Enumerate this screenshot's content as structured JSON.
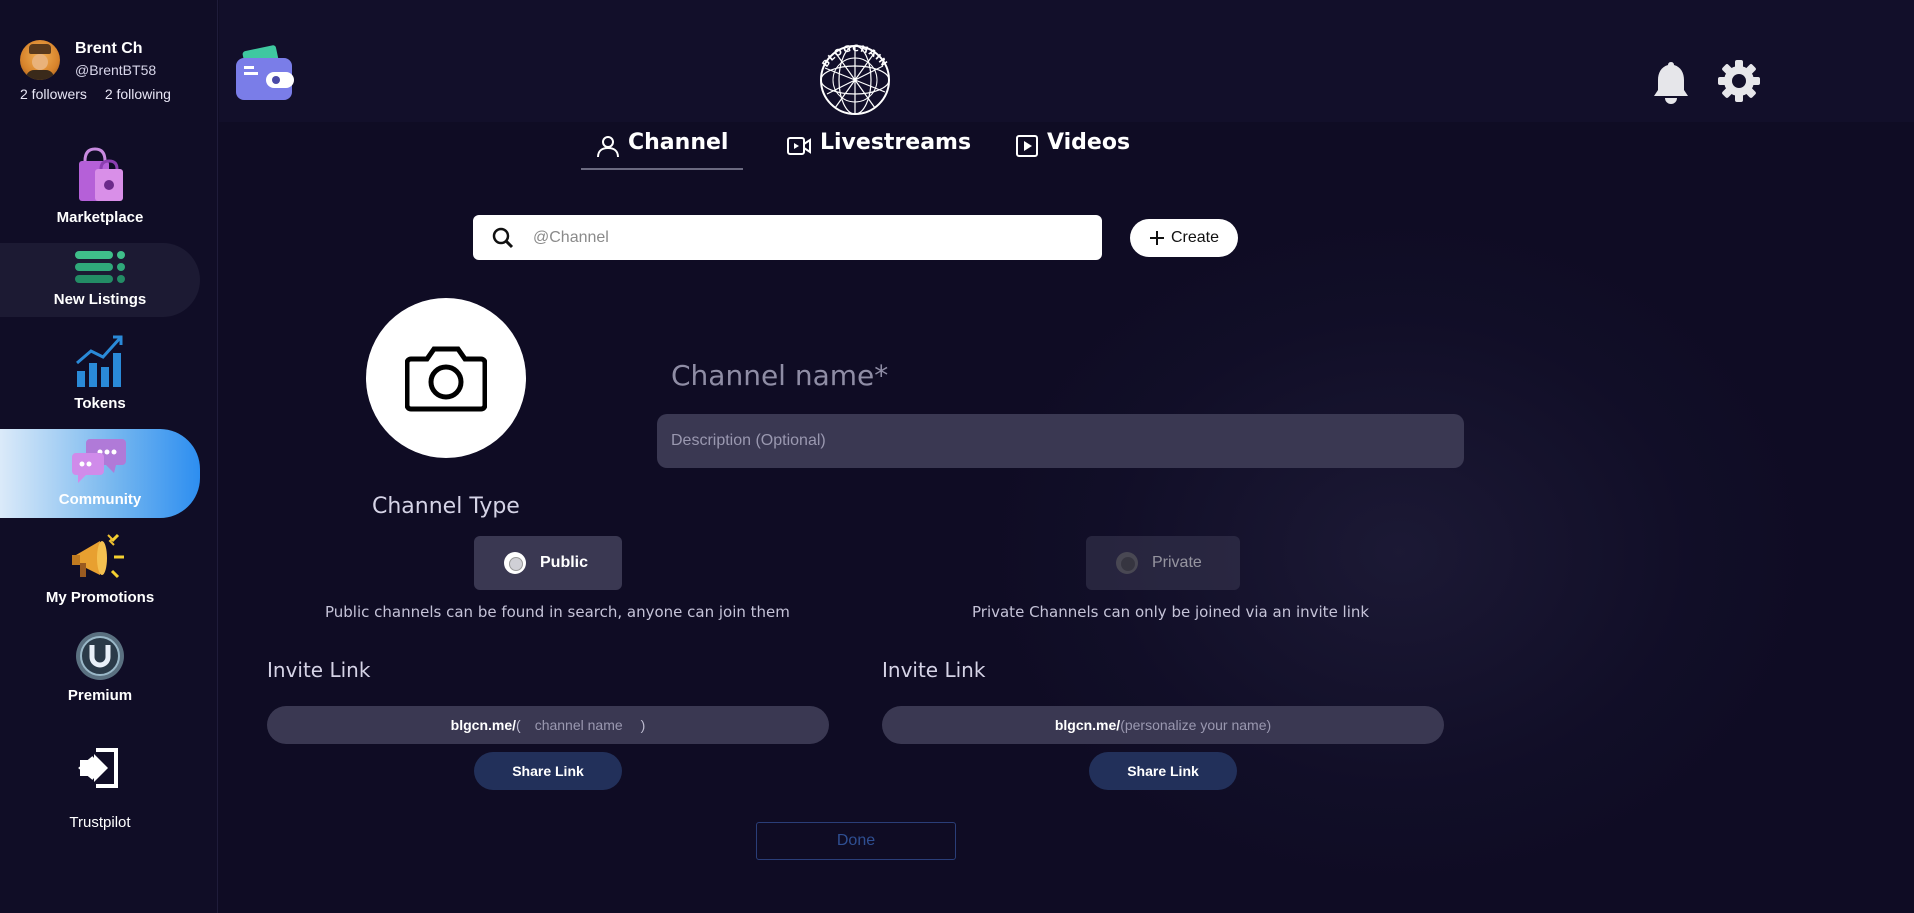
{
  "profile": {
    "name": "Brent Ch",
    "handle": "@BrentBT58",
    "followers": "2 followers",
    "following": "2 following"
  },
  "sidebar": {
    "items": [
      {
        "label": "Marketplace",
        "icon": "shopping-bags-icon"
      },
      {
        "label": "New Listings",
        "icon": "list-icon"
      },
      {
        "label": "Tokens",
        "icon": "chart-growth-icon"
      },
      {
        "label": "Community",
        "icon": "chat-bubbles-icon",
        "active": true
      },
      {
        "label": "My Promotions",
        "icon": "megaphone-icon"
      },
      {
        "label": "Premium",
        "icon": "premium-badge-icon"
      },
      {
        "label": "Trustpilot",
        "icon": "logout-icon"
      }
    ]
  },
  "header": {
    "logo_text": "BLOGCHAIN"
  },
  "tabs": [
    {
      "label": "Channel",
      "icon": "user-icon",
      "active": true
    },
    {
      "label": "Livestreams",
      "icon": "video-camera-icon"
    },
    {
      "label": "Videos",
      "icon": "play-square-icon"
    }
  ],
  "search": {
    "placeholder": "@Channel"
  },
  "create_label": "Create",
  "form": {
    "channel_name_placeholder": "Channel name*",
    "description_placeholder": "Description (Optional)",
    "channel_type_label": "Channel Type",
    "public_label": "Public",
    "private_label": "Private",
    "public_desc": "Public channels can be found in search, anyone can join them",
    "private_desc": "Private Channels can only be joined via an invite link",
    "invite_label": "Invite Link",
    "link_prefix": "blgcn.me/",
    "open_paren": "(",
    "close_paren": ")",
    "public_link_placeholder": "channel name",
    "private_link_placeholder": "(personalize your name)",
    "share_label": "Share Link",
    "done_label": "Done"
  },
  "colors": {
    "background": "#0f0c24",
    "active_gradient_end": "#2d8ef0",
    "field_bg": "#3a3852",
    "share_bg": "#22305a"
  }
}
